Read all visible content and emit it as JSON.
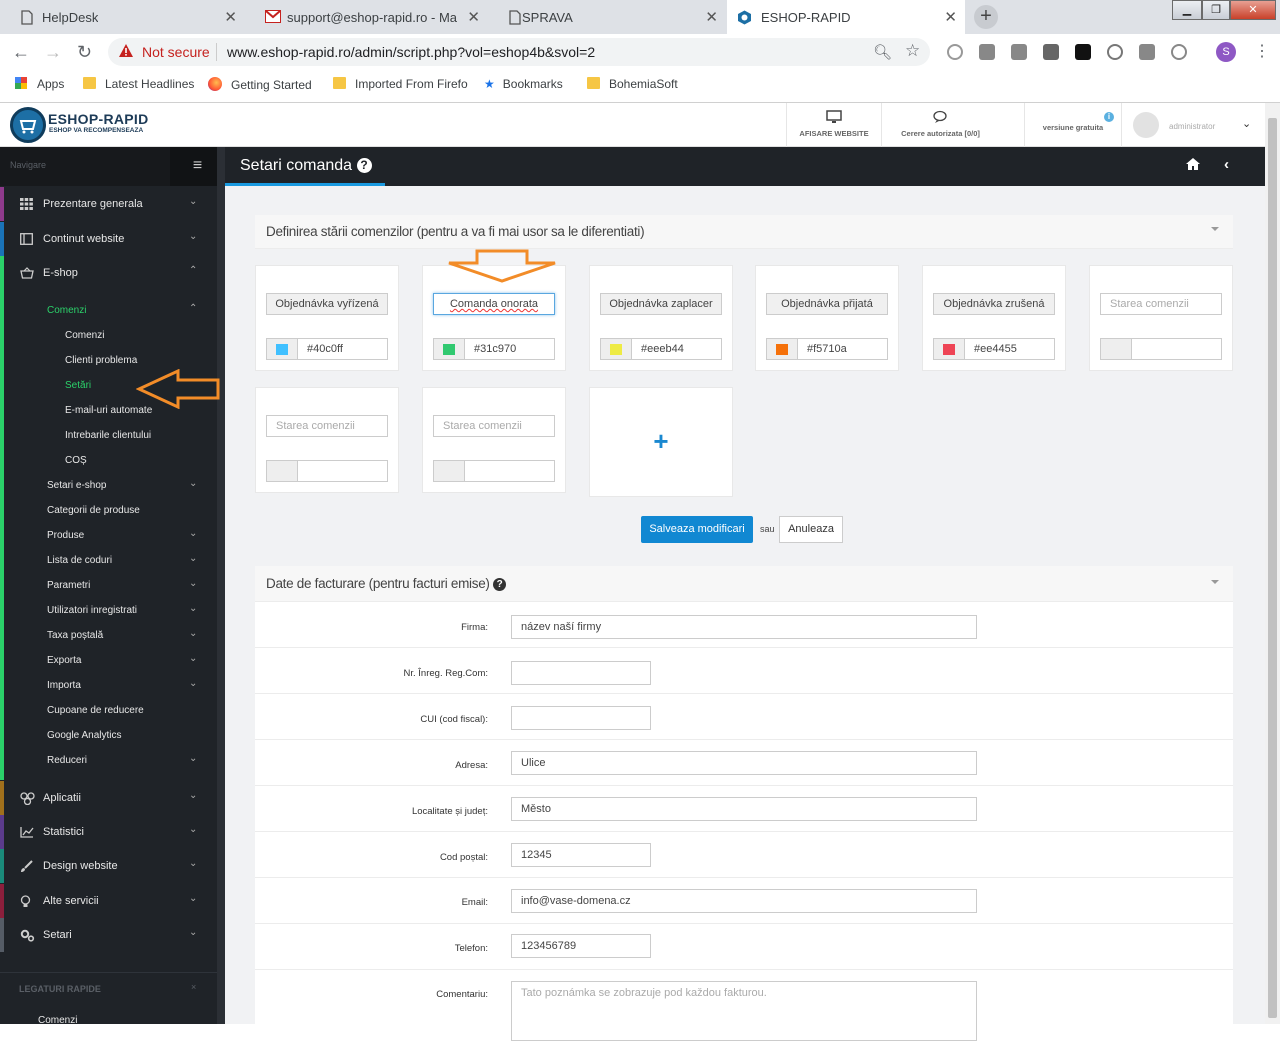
{
  "browser": {
    "tabs": [
      {
        "label": "HelpDesk"
      },
      {
        "label": "support@eshop-rapid.ro - Mail -"
      },
      {
        "label": "SPRAVA"
      },
      {
        "label": "ESHOP-RAPID"
      }
    ],
    "new_tab": "+",
    "security": "Not secure",
    "url": "www.eshop-rapid.ro/admin/script.php?vol=eshop4b&svol=2",
    "profile_initial": "S",
    "bookmarks": [
      "Apps",
      "Latest Headlines",
      "Getting Started",
      "Imported From Firefo",
      "Bookmarks",
      "BohemiaSoft"
    ]
  },
  "header": {
    "logo_title": "ESHOP-RAPID",
    "logo_subtitle": "ESHOP VA RECOMPENSEAZA",
    "view_site": "AFISARE WEBSITE",
    "auth_request": "Cerere autorizata [0/0]",
    "version": "versiune gratuita",
    "user": "administrator"
  },
  "sidebar": {
    "nav_label": "Navigare",
    "main_items": [
      {
        "label": "Prezentare generala",
        "icon": "grid-icon",
        "color": "#8e3a8c"
      },
      {
        "label": "Continut website",
        "icon": "window-icon",
        "color": "#1a73b8"
      },
      {
        "label": "E-shop",
        "icon": "basket-icon",
        "color": "#2bd16a"
      }
    ],
    "eshop_sub": [
      {
        "label": "Comenzi",
        "active": true
      },
      {
        "label": "Setari e-shop"
      },
      {
        "label": "Categorii de produse"
      },
      {
        "label": "Produse"
      },
      {
        "label": "Lista de coduri"
      },
      {
        "label": "Parametri"
      },
      {
        "label": "Utilizatori inregistrati"
      },
      {
        "label": "Taxa poștală"
      },
      {
        "label": "Exporta"
      },
      {
        "label": "Importa"
      },
      {
        "label": "Cupoane de reducere"
      },
      {
        "label": "Google Analytics"
      },
      {
        "label": "Reduceri"
      }
    ],
    "comenzi_sub": [
      {
        "label": "Comenzi"
      },
      {
        "label": "Clienti problema"
      },
      {
        "label": "Setări",
        "active": true
      },
      {
        "label": "E-mail-uri automate"
      },
      {
        "label": "Intrebarile clientului"
      },
      {
        "label": "COȘ"
      }
    ],
    "bottom_items": [
      {
        "label": "Aplicatii",
        "icon": "apps-icon",
        "color": "#a0701c"
      },
      {
        "label": "Statistici",
        "icon": "chart-icon",
        "color": "#5b3b8c"
      },
      {
        "label": "Design website",
        "icon": "brush-icon",
        "color": "#1a8a7a"
      },
      {
        "label": "Alte servicii",
        "icon": "bulb-icon",
        "color": "#8c1f3c"
      },
      {
        "label": "Setari",
        "icon": "gears-icon",
        "color": "#555c66"
      }
    ],
    "quick_links_title": "LEGATURI RAPIDE",
    "quick_links": [
      "Comenzi"
    ]
  },
  "page": {
    "title": "Setari comanda"
  },
  "order_states": {
    "panel_title": "Definirea stării comenzilor (pentru a va fi mai usor sa le diferentiati)",
    "placeholder": "Starea comenzii",
    "cards": [
      {
        "name": "Objednávka vyřízená",
        "color": "#40c0ff",
        "hex": "#40c0ff"
      },
      {
        "name": "Comanda onorata",
        "color": "#31c970",
        "hex": "#31c970"
      },
      {
        "name": "Objednávka zaplacer",
        "color": "#eeeb44",
        "hex": "#eeeb44"
      },
      {
        "name": "Objednávka přijatá",
        "color": "#f5710a",
        "hex": "#f5710a"
      },
      {
        "name": "Objednávka zrušená",
        "color": "#ee4455",
        "hex": "#ee4455"
      },
      {
        "name": "",
        "color": "",
        "hex": ""
      },
      {
        "name": "",
        "color": "",
        "hex": ""
      },
      {
        "name": "",
        "color": "",
        "hex": ""
      }
    ],
    "add": "+",
    "save": "Salveaza modificari",
    "or": "sau",
    "cancel": "Anuleaza"
  },
  "billing": {
    "panel_title": "Date de facturare (pentru facturi emise)",
    "fields": [
      {
        "label": "Firma:",
        "value": "název naší firmy"
      },
      {
        "label": "Nr. Înreg. Reg.Com:",
        "value": ""
      },
      {
        "label": "CUI (cod fiscal):",
        "value": ""
      },
      {
        "label": "Adresa:",
        "value": "Ulice"
      },
      {
        "label": "Localitate și județ:",
        "value": "Město"
      },
      {
        "label": "Cod poștal:",
        "value": "12345"
      },
      {
        "label": "Email:",
        "value": "info@vase-domena.cz"
      },
      {
        "label": "Telefon:",
        "value": "123456789"
      },
      {
        "label": "Comentariu:",
        "value": "",
        "placeholder": "Tato poznámka se zobrazuje pod každou fakturou."
      }
    ]
  },
  "colors": {
    "accent": "#1188d2",
    "sidebar_bg": "#1f2328",
    "active_green": "#2bd16a",
    "annotation_arrow": "#f28c28"
  }
}
